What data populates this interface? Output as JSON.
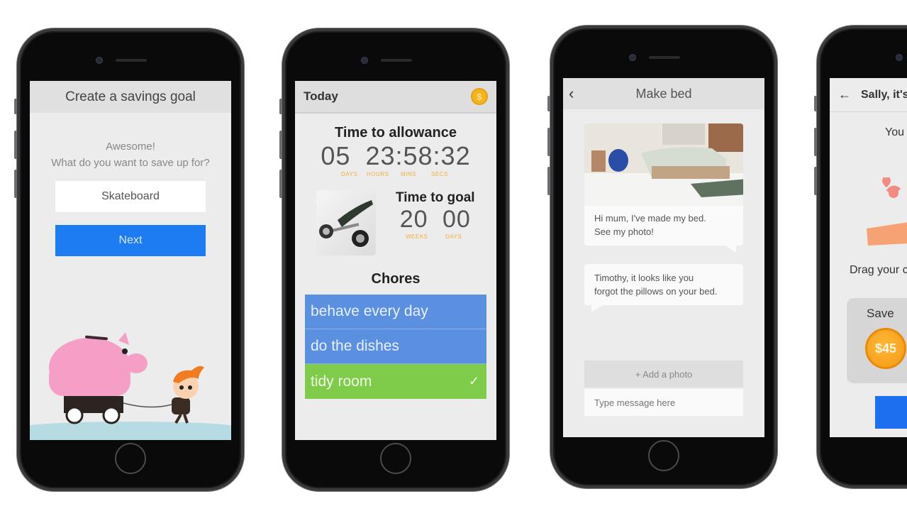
{
  "phones": {
    "savings_goal": {
      "header_title": "Create a savings goal",
      "message_line1": "Awesome!",
      "message_line2": "What do you want to save up for?",
      "goal_input_value": "Skateboard",
      "next_label": "Next",
      "illustration": "boy-pulling-piggy-bank-on-wagon"
    },
    "today": {
      "header_title": "Today",
      "header_icon": "dollar-coin-icon",
      "allowance_title": "Time to allowance",
      "allowance_days": "05",
      "allowance_time": "23:58:32",
      "allowance_units": [
        "DAYS",
        "HOURS",
        "MINS",
        "SECS"
      ],
      "goal_title": "Time to goal",
      "goal_weeks": "20",
      "goal_days": "00",
      "goal_units": [
        "WEEKS",
        "DAYS"
      ],
      "goal_image": "electric-skateboard-photo",
      "chores_title": "Chores",
      "chores": [
        {
          "label": "behave every day",
          "done": false,
          "color": "#5b8fe0"
        },
        {
          "label": "do the dishes",
          "done": false,
          "color": "#5b8fe0"
        },
        {
          "label": "tidy room",
          "done": true,
          "color": "#7fcb4a"
        }
      ],
      "check_glyph": "✓"
    },
    "make_bed": {
      "header_title": "Make bed",
      "back_glyph": "‹",
      "photo": "bedroom-photo",
      "message_child_line1": "Hi mum, I've made my bed.",
      "message_child_line2": "See my photo!",
      "message_parent_line1": "Timothy, it looks like you",
      "message_parent_line2": "forgot the pillows on your bed.",
      "add_photo_label": "+ Add a photo",
      "message_placeholder": "Type message here"
    },
    "payday": {
      "back_glyph": "←",
      "header_title": "Sally, it's",
      "intro_text": "You",
      "drag_text": "Drag your c",
      "save_label": "Save",
      "coin_amount": "$45"
    }
  },
  "colors": {
    "primary_blue": "#1e7cf2",
    "chore_blue": "#5b8fe0",
    "chore_green": "#7fcb4a",
    "accent_orange": "#f0b040",
    "coin_gold": "#f2b51e"
  }
}
